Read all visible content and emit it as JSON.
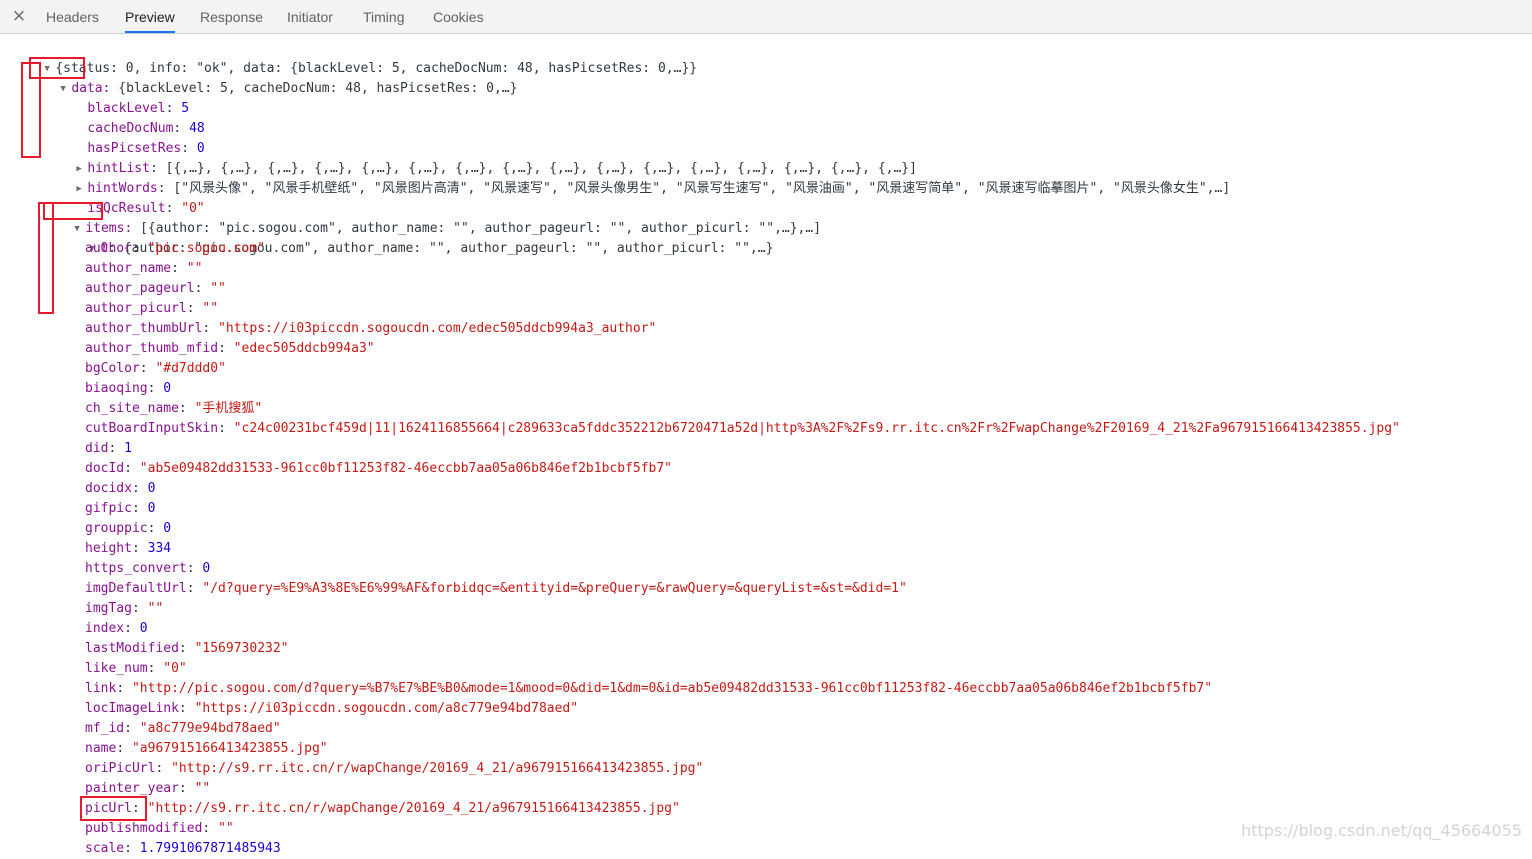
{
  "tabs": {
    "close_icon": "×",
    "items": [
      "Headers",
      "Preview",
      "Response",
      "Initiator",
      "Timing",
      "Cookies"
    ],
    "active": "Preview"
  },
  "tree": {
    "root": "{status: 0, info: \"ok\", data: {blackLevel: 5, cacheDocNum: 48, hasPicsetRes: 0,…}}",
    "data_key": "data:",
    "data_summary": " {blackLevel: 5, cacheDocNum: 48, hasPicsetRes: 0,…}",
    "blackLevel": {
      "key": "blackLevel",
      "value": "5"
    },
    "cacheDocNum": {
      "key": "cacheDocNum",
      "value": "48"
    },
    "hasPicsetRes": {
      "key": "hasPicsetRes",
      "value": "0"
    },
    "hintList": {
      "key": "hintList",
      "value": "[{,…}, {,…}, {,…}, {,…}, {,…}, {,…}, {,…}, {,…}, {,…}, {,…}, {,…}, {,…}, {,…}, {,…}, {,…}, {,…}]"
    },
    "hintWords": {
      "key": "hintWords",
      "value": "[\"风景头像\", \"风景手机壁纸\", \"风景图片高清\", \"风景速写\", \"风景头像男生\", \"风景写生速写\", \"风景油画\", \"风景速写简单\", \"风景速写临摹图片\", \"风景头像女生\",…]"
    },
    "isQcResult": {
      "key": "isQcResult",
      "value": "\"0\""
    },
    "items_key": "items:",
    "items_summary": " [{author: \"pic.sogou.com\", author_name: \"\", author_pageurl: \"\", author_picurl: \"\",…},…]",
    "item0_key": "0",
    "item0_summary": ": {author: \"pic.sogou.com\", author_name: \"\", author_pageurl: \"\", author_picurl: \"\",…}",
    "fields": [
      {
        "key": "author",
        "value": "\"pic.sogou.com\"",
        "type": "string"
      },
      {
        "key": "author_name",
        "value": "\"\"",
        "type": "string"
      },
      {
        "key": "author_pageurl",
        "value": "\"\"",
        "type": "string"
      },
      {
        "key": "author_picurl",
        "value": "\"\"",
        "type": "string"
      },
      {
        "key": "author_thumbUrl",
        "value": "\"https://i03piccdn.sogoucdn.com/edec505ddcb994a3_author\"",
        "type": "string"
      },
      {
        "key": "author_thumb_mfid",
        "value": "\"edec505ddcb994a3\"",
        "type": "string"
      },
      {
        "key": "bgColor",
        "value": "\"#d7ddd0\"",
        "type": "string"
      },
      {
        "key": "biaoqing",
        "value": "0",
        "type": "number"
      },
      {
        "key": "ch_site_name",
        "value": "\"手机搜狐\"",
        "type": "string"
      },
      {
        "key": "cutBoardInputSkin",
        "value": "\"c24c00231bcf459d|11|1624116855664|c289633ca5fddc352212b6720471a52d|http%3A%2F%2Fs9.rr.itc.cn%2Fr%2FwapChange%2F20169_4_21%2Fa967915166413423855.jpg\"",
        "type": "string"
      },
      {
        "key": "did",
        "value": "1",
        "type": "number"
      },
      {
        "key": "docId",
        "value": "\"ab5e09482dd31533-961cc0bf11253f82-46eccbb7aa05a06b846ef2b1bcbf5fb7\"",
        "type": "string"
      },
      {
        "key": "docidx",
        "value": "0",
        "type": "number"
      },
      {
        "key": "gifpic",
        "value": "0",
        "type": "number"
      },
      {
        "key": "grouppic",
        "value": "0",
        "type": "number"
      },
      {
        "key": "height",
        "value": "334",
        "type": "number"
      },
      {
        "key": "https_convert",
        "value": "0",
        "type": "number"
      },
      {
        "key": "imgDefaultUrl",
        "value": "\"/d?query=%E9%A3%8E%E6%99%AF&forbidqc=&entityid=&preQuery=&rawQuery=&queryList=&st=&did=1\"",
        "type": "string"
      },
      {
        "key": "imgTag",
        "value": "\"\"",
        "type": "string"
      },
      {
        "key": "index",
        "value": "0",
        "type": "number"
      },
      {
        "key": "lastModified",
        "value": "\"1569730232\"",
        "type": "string"
      },
      {
        "key": "like_num",
        "value": "\"0\"",
        "type": "string"
      },
      {
        "key": "link",
        "value": "\"http://pic.sogou.com/d?query=%B7%E7%BE%B0&mode=1&mood=0&did=1&dm=0&id=ab5e09482dd31533-961cc0bf11253f82-46eccbb7aa05a06b846ef2b1bcbf5fb7\"",
        "type": "string"
      },
      {
        "key": "locImageLink",
        "value": "\"https://i03piccdn.sogoucdn.com/a8c779e94bd78aed\"",
        "type": "string"
      },
      {
        "key": "mf_id",
        "value": "\"a8c779e94bd78aed\"",
        "type": "string"
      },
      {
        "key": "name",
        "value": "\"a967915166413423855.jpg\"",
        "type": "string"
      },
      {
        "key": "oriPicUrl",
        "value": "\"http://s9.rr.itc.cn/r/wapChange/20169_4_21/a967915166413423855.jpg\"",
        "type": "string"
      },
      {
        "key": "painter_year",
        "value": "\"\"",
        "type": "string"
      },
      {
        "key": "picUrl",
        "value": "\"http://s9.rr.itc.cn/r/wapChange/20169_4_21/a967915166413423855.jpg\"",
        "type": "string"
      },
      {
        "key": "publishmodified",
        "value": "\"\"",
        "type": "string"
      },
      {
        "key": "scale",
        "value": "1.7991067871485943",
        "type": "number"
      }
    ]
  },
  "watermark": "https://blog.csdn.net/qq_45664055",
  "colors": {
    "key": "#881391",
    "string": "#c41a16",
    "number": "#1c00cf",
    "punct": "#303942",
    "annotation": "#e8192c",
    "active_tab_underline": "#1a73e8"
  }
}
